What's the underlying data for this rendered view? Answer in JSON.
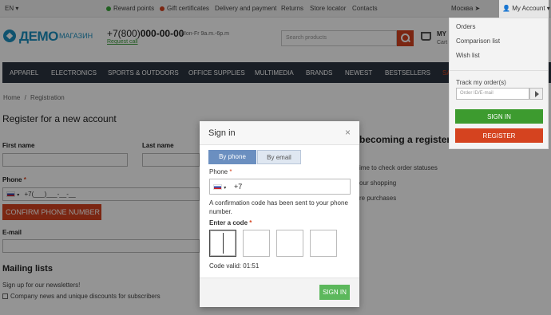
{
  "topbar": {
    "language": "EN",
    "links": [
      "Reward points",
      "Gift certificates",
      "Delivery and payment",
      "Returns",
      "Store locator",
      "Contacts"
    ],
    "city": "Москва",
    "account": "My Account"
  },
  "header": {
    "logo": "ДЕМО",
    "logo_sub": "МАГАЗИН",
    "phone_prefix": "+7(800)",
    "phone_number": "000-00-00",
    "hours": "Mon-Fr 9a.m.-6p.m",
    "call_request": "Request call",
    "search_placeholder": "Search products",
    "cart_title": "MY",
    "cart_sub": "Cart"
  },
  "nav": [
    "APPAREL",
    "ELECTRONICS",
    "SPORTS & OUTDOORS",
    "OFFICE SUPPLIES",
    "MULTIMEDIA",
    "BRANDS",
    "NEWEST",
    "BESTSELLERS",
    "SA"
  ],
  "page": {
    "breadcrumb": [
      "Home",
      "Registration"
    ],
    "breadcrumb_sep": "/",
    "title": "Register for a new account",
    "first_name": "First name",
    "last_name": "Last name",
    "phone_label": "Phone",
    "required_mark": "*",
    "phone_mask": "+7(___)___-__-__",
    "confirm_button": "CONFIRM PHONE NUMBER",
    "email_label": "E-mail",
    "mailing_title": "Mailing lists",
    "mailing_text": "Sign up for our newsletters!",
    "mailing_option": "Company news and unique discounts for subscribers",
    "right_heading": "becoming a registere",
    "right_items": [
      "ime to check order statuses",
      "our shopping",
      "re purchases"
    ]
  },
  "dropdown": {
    "items": [
      "Orders",
      "Comparison list",
      "Wish list"
    ],
    "track_label": "Track my order(s)",
    "track_placeholder": "Order ID/E-mail",
    "sign_in": "SIGN IN",
    "register": "REGISTER"
  },
  "modal": {
    "title": "Sign in",
    "close": "×",
    "tab_phone": "By phone",
    "tab_email": "By email",
    "phone_label": "Phone",
    "phone_value": "+7",
    "info_text": "A confirmation code has been sent to your phone number.",
    "code_label": "Enter a code",
    "code_valid": "Code valid: 01:51",
    "sign_in_button": "SIGN IN"
  },
  "colors": {
    "accent": "#1c8fbf",
    "danger": "#d5431f",
    "success": "#5cb85c",
    "nav_bg": "#2b3440"
  }
}
